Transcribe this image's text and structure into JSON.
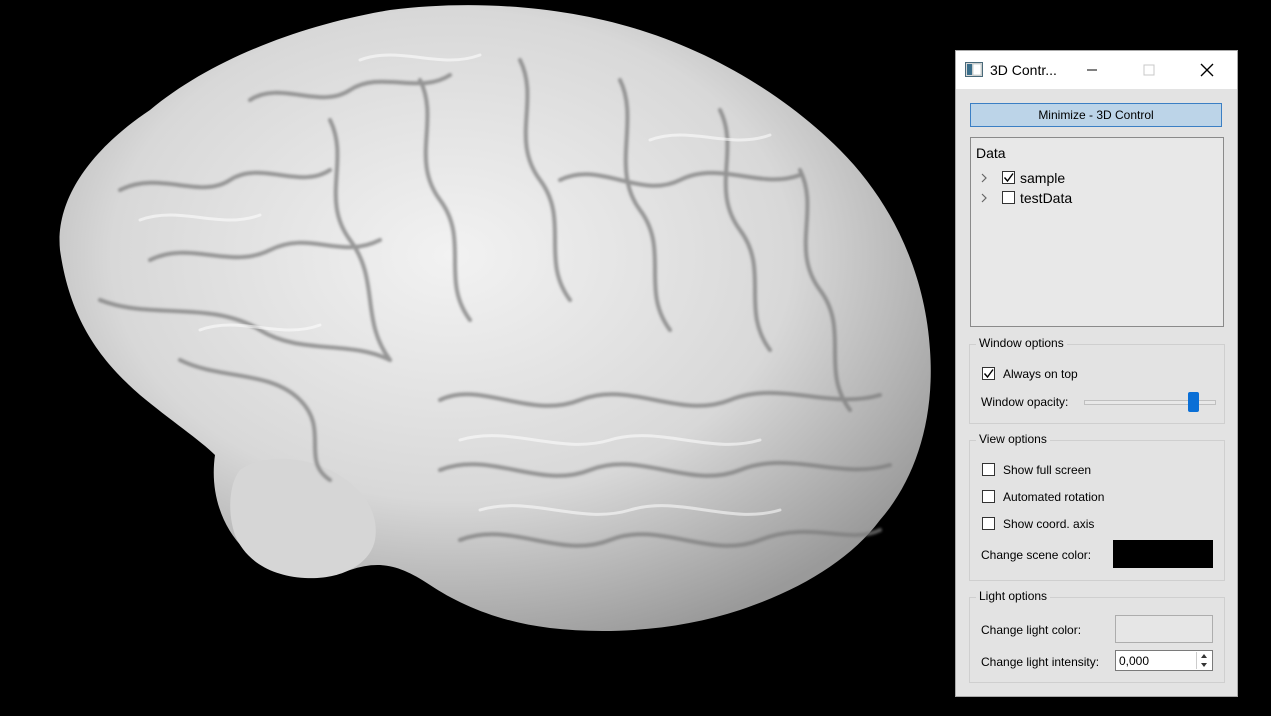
{
  "window": {
    "title": "3D Contr..."
  },
  "minimize_button": "Minimize - 3D Control",
  "data_tree": {
    "header": "Data",
    "items": [
      {
        "label": "sample",
        "checked": true
      },
      {
        "label": "testData",
        "checked": false
      }
    ]
  },
  "window_options": {
    "title": "Window options",
    "always_on_top": {
      "label": "Always on top",
      "checked": true
    },
    "opacity_label": "Window opacity:",
    "opacity_value": 0.83
  },
  "view_options": {
    "title": "View options",
    "show_full_screen": {
      "label": "Show full screen",
      "checked": false
    },
    "automated_rotation": {
      "label": "Automated rotation",
      "checked": false
    },
    "show_coord_axis": {
      "label": "Show coord. axis",
      "checked": false
    },
    "scene_color_label": "Change scene color:",
    "scene_color": "#000000"
  },
  "light_options": {
    "title": "Light options",
    "light_color_label": "Change light color:",
    "light_color": "#e6e6e6",
    "intensity_label": "Change light intensity:",
    "intensity_value": "0,000"
  },
  "icons": [
    "app-icon",
    "minimize-icon",
    "maximize-icon",
    "close-icon",
    "chevron-right-icon",
    "checkmark-icon",
    "spin-up-icon",
    "spin-down-icon"
  ]
}
